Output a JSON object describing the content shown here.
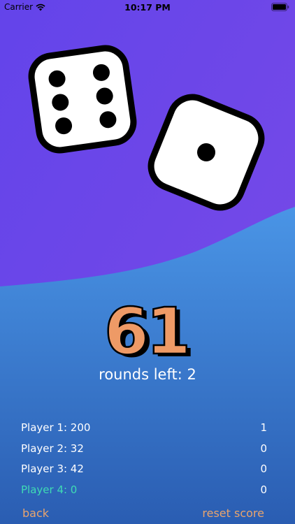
{
  "status_bar": {
    "carrier": "Carrier",
    "time": "10:17 PM"
  },
  "colors": {
    "bg_top": "#6a45e8",
    "bg_bottom_start": "#3f88dd",
    "bg_bottom_end": "#2a5fb5",
    "score_fill": "#ee9a66",
    "active_player": "#3fdcb4",
    "footer_link": "#e9a46d"
  },
  "dice": [
    {
      "value": 6
    },
    {
      "value": 1
    }
  ],
  "score": {
    "value": "61"
  },
  "rounds": {
    "text": "rounds left: 2"
  },
  "players": [
    {
      "label": "Player 1: 200",
      "count": "1",
      "active": false
    },
    {
      "label": "Player 2: 32",
      "count": "0",
      "active": false
    },
    {
      "label": "Player 3: 42",
      "count": "0",
      "active": false
    },
    {
      "label": "Player 4: 0",
      "count": "0",
      "active": true
    }
  ],
  "footer": {
    "back_label": "back",
    "reset_label": "reset score"
  }
}
